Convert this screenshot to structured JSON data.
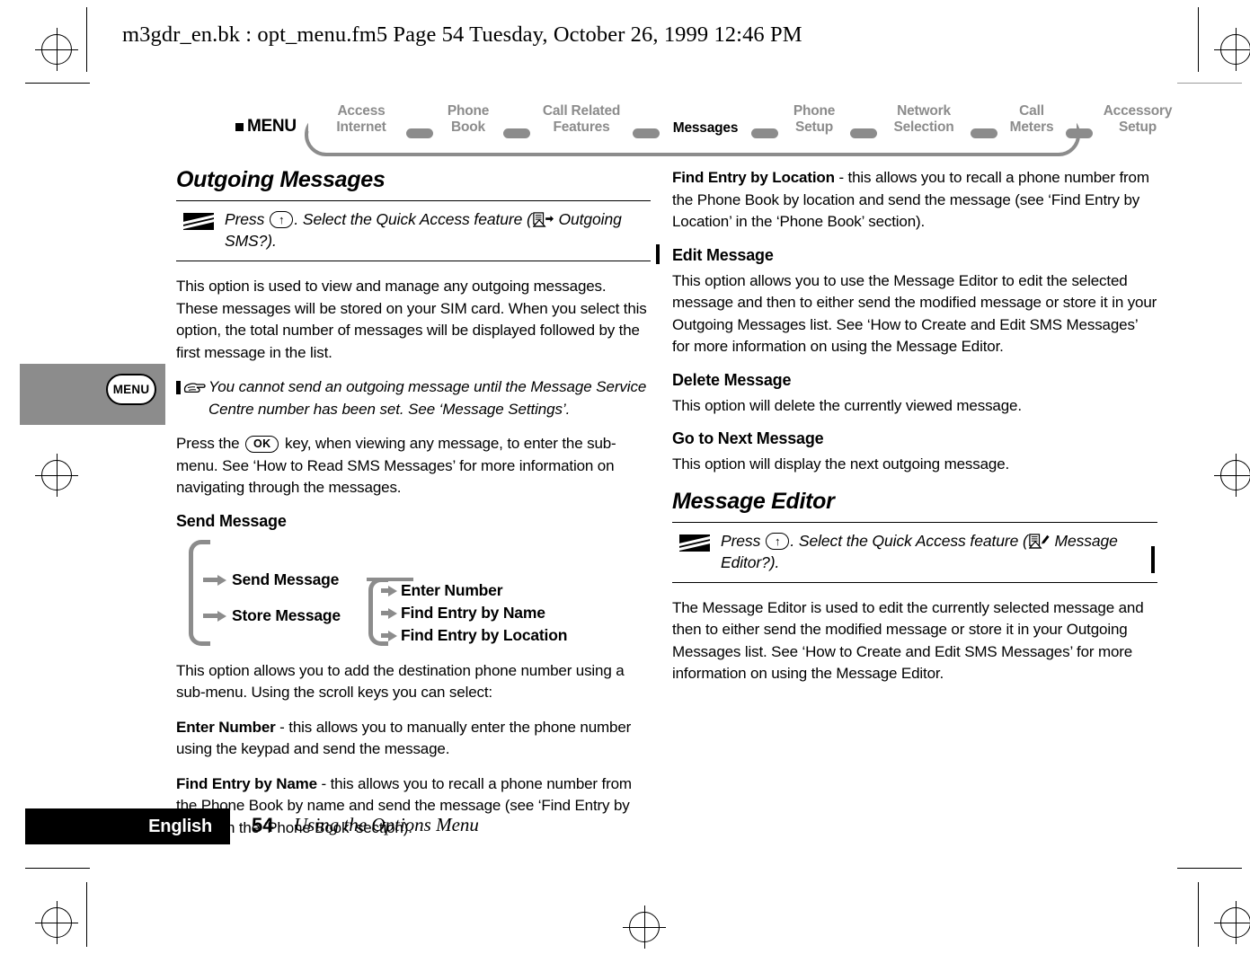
{
  "file_header": "m3gdr_en.bk : opt_menu.fm5  Page 54  Tuesday, October 26, 1999  12:46 PM",
  "nav": {
    "menu_label": "MENU",
    "items": [
      {
        "line1": "Access",
        "line2": "Internet",
        "active": false
      },
      {
        "line1": "Phone",
        "line2": "Book",
        "active": false
      },
      {
        "line1": "Call Related",
        "line2": "Features",
        "active": false
      },
      {
        "line1": "Messages",
        "line2": "",
        "active": true
      },
      {
        "line1": "Phone",
        "line2": "Setup",
        "active": false
      },
      {
        "line1": "Network",
        "line2": "Selection",
        "active": false
      },
      {
        "line1": "Call",
        "line2": "Meters",
        "active": false
      },
      {
        "line1": "Accessory",
        "line2": "Setup",
        "active": false
      }
    ]
  },
  "margin_tab": {
    "key_label": "MENU"
  },
  "left_column": {
    "title": "Outgoing Messages",
    "quick_access": {
      "press_prefix": "Press",
      "key": "↑",
      "mid": ". Select the Quick Access feature (",
      "icon_name": "outgoing-message-icon",
      "suffix": " Outgoing SMS?)."
    },
    "paragraph_1": "This option is used to view and manage any outgoing messages. These messages will be stored on your SIM card. When you select this option, the total number of messages will be displayed followed by the first message in the list.",
    "note": "You cannot send an outgoing message until the Message Service Centre number has been set. See ‘Message Settings’.",
    "paragraph_2_pre": "Press the",
    "paragraph_2_key": "OK",
    "paragraph_2_post": "key, when viewing any message, to enter the sub-menu. See ‘How to Read SMS Messages’ for more information on navigating through the messages.",
    "send_message_heading": "Send Message",
    "tree": {
      "level1": [
        "Send Message",
        "Store Message"
      ],
      "level2": [
        "Enter Number",
        "Find Entry by Name",
        "Find Entry by Location"
      ]
    },
    "paragraph_3": "This option allows you to add the destination phone number using a sub-menu. Using the scroll keys you can select:",
    "item_enter_number_term": "Enter Number",
    "item_enter_number_desc": " - this allows you to manually enter the phone number using the keypad and send the message.",
    "item_find_name_term": "Find Entry by Name",
    "item_find_name_desc": " - this allows you to recall a phone number from the Phone Book by name and send the message (see ‘Find Entry by Name’ in the ‘Phone Book’ section)."
  },
  "right_column": {
    "item_find_location_term": "Find Entry by Location",
    "item_find_location_desc": " - this allows you to recall a phone number from the Phone Book by location and send the message (see ‘Find Entry by Location’ in the ‘Phone Book’ section).",
    "edit_message_heading": "Edit Message",
    "edit_message_body": "This option allows you to use the Message Editor to edit the selected message and then to either send the modified message or store it in your Outgoing Messages list. See ‘How to Create and Edit SMS Messages’ for more information on using the Message Editor.",
    "delete_message_heading": "Delete Message",
    "delete_message_body": "This option will delete the currently viewed message.",
    "go_next_heading": "Go to Next Message",
    "go_next_body": "This option will display the next outgoing message.",
    "message_editor_title": "Message Editor",
    "quick_access": {
      "press_prefix": "Press",
      "key": "↑",
      "mid": ". Select the Quick Access feature (",
      "icon_name": "message-editor-icon",
      "suffix": " Message Editor?)."
    },
    "message_editor_body": "The Message Editor is used to edit the currently selected message and then to either send the modified message or store it in your Outgoing Messages list. See ‘How to Create and Edit SMS Messages’ for more information on using the Message Editor."
  },
  "footer": {
    "language": "English",
    "page_number": "54",
    "chapter": "Using the Options Menu"
  },
  "colors": {
    "nav_inactive": "#8c8c8c",
    "nav_active": "#000000",
    "margin_tab": "#8c8c8c",
    "footer_bar": "#000000"
  }
}
